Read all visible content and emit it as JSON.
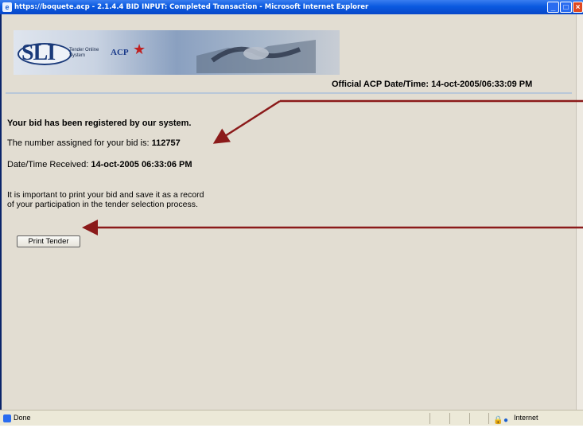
{
  "window": {
    "title": "https://boquete.acp - 2.1.4.4 BID INPUT: Completed Transaction - Microsoft Internet Explorer"
  },
  "banner": {
    "logo_text": "SLI",
    "logo_subtitle_line1": "Tender Online",
    "logo_subtitle_line2": "System",
    "acp_text": "ACP"
  },
  "header": {
    "datetime_label": "Official ACP Date/Time:",
    "datetime_value": "14-oct-2005/06:33:09 PM"
  },
  "main": {
    "registered_message": "Your bid has been registered by our system.",
    "bid_number_label": "The number assigned for your bid is:",
    "bid_number_value": "112757",
    "received_label": "Date/Time Received:",
    "received_value": "14-oct-2005 06:33:06 PM",
    "notice_line1": "It is important to print your bid and save it as a record",
    "notice_line2": "of your participation in the tender selection process.",
    "print_button_label": "Print Tender"
  },
  "statusbar": {
    "status_text": "Done",
    "zone_text": "Internet"
  },
  "annotations": {
    "arrow_color": "#8b1a1a"
  }
}
